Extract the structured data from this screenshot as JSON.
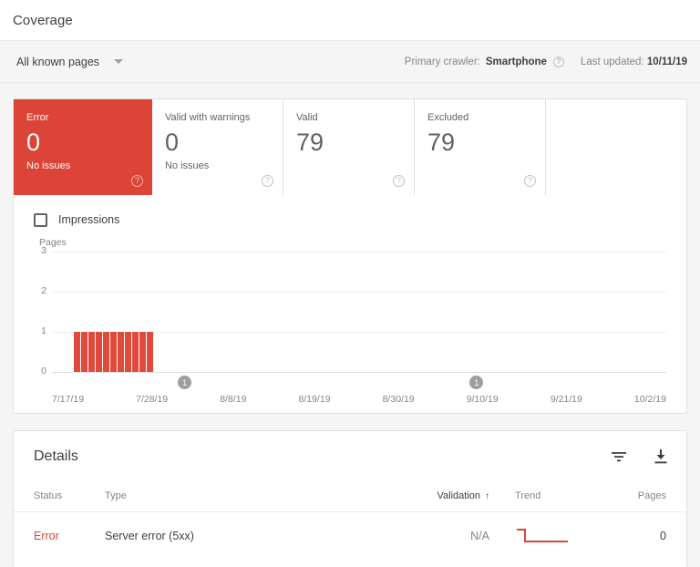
{
  "header": {
    "title": "Coverage"
  },
  "toolbar": {
    "page_filter": "All known pages",
    "dropdown_icon": "chevron-down-icon",
    "crawler_label": "Primary crawler:",
    "crawler_value": "Smartphone",
    "crawler_help_icon": "help-circle-icon",
    "updated_label": "Last updated:",
    "updated_value": "10/11/19"
  },
  "status_cards": [
    {
      "label": "Error",
      "count": "0",
      "sub": "No issues",
      "help_icon": "help-circle-icon",
      "color": "#DB4437",
      "selected": true
    },
    {
      "label": "Valid with warnings",
      "count": "0",
      "sub": "No issues",
      "help_icon": "help-circle-icon",
      "color": "#FFFFFF",
      "selected": false
    },
    {
      "label": "Valid",
      "count": "79",
      "sub": "",
      "help_icon": "help-circle-icon",
      "color": "#FFFFFF",
      "selected": false
    },
    {
      "label": "Excluded",
      "count": "79",
      "sub": "",
      "help_icon": "help-circle-icon",
      "color": "#FFFFFF",
      "selected": false
    }
  ],
  "impressions": {
    "label": "Impressions",
    "checked": false,
    "checkbox_icon": "checkbox-unchecked-icon"
  },
  "chart_data": {
    "type": "bar",
    "title": "",
    "xlabel": "",
    "ylabel": "Pages",
    "ylim": [
      0,
      3
    ],
    "yticks": [
      0,
      1,
      2,
      3
    ],
    "grid": true,
    "legend": "none",
    "series": [
      {
        "name": "Error",
        "color": "#E04A3C",
        "values": [
          1,
          1,
          1,
          1,
          1,
          1,
          1,
          1,
          1,
          1,
          1
        ]
      }
    ],
    "x_tick_labels": [
      "7/17/19",
      "7/28/19",
      "8/8/19",
      "8/19/19",
      "8/30/19",
      "9/10/19",
      "9/21/19",
      "10/2/19"
    ],
    "bar_start_index": 3,
    "total_slots": 88,
    "annotations": [
      {
        "label": "1",
        "position_pct": 20.5
      },
      {
        "label": "1",
        "position_pct": 68.0
      }
    ]
  },
  "details": {
    "title": "Details",
    "filter_icon": "filter-icon",
    "download_icon": "download-icon",
    "columns": [
      {
        "key": "status",
        "label": "Status",
        "sorted": false
      },
      {
        "key": "type",
        "label": "Type",
        "sorted": false
      },
      {
        "key": "validation",
        "label": "Validation",
        "sorted": true,
        "sort_arrow": "↑"
      },
      {
        "key": "trend",
        "label": "Trend",
        "sorted": false
      },
      {
        "key": "pages",
        "label": "Pages",
        "sorted": false
      }
    ],
    "rows": [
      {
        "status": "Error",
        "type": "Server error (5xx)",
        "validation": "N/A",
        "trend_icon": "sparkline-declining",
        "trend_color": "#DB4437",
        "pages": "0"
      }
    ]
  }
}
